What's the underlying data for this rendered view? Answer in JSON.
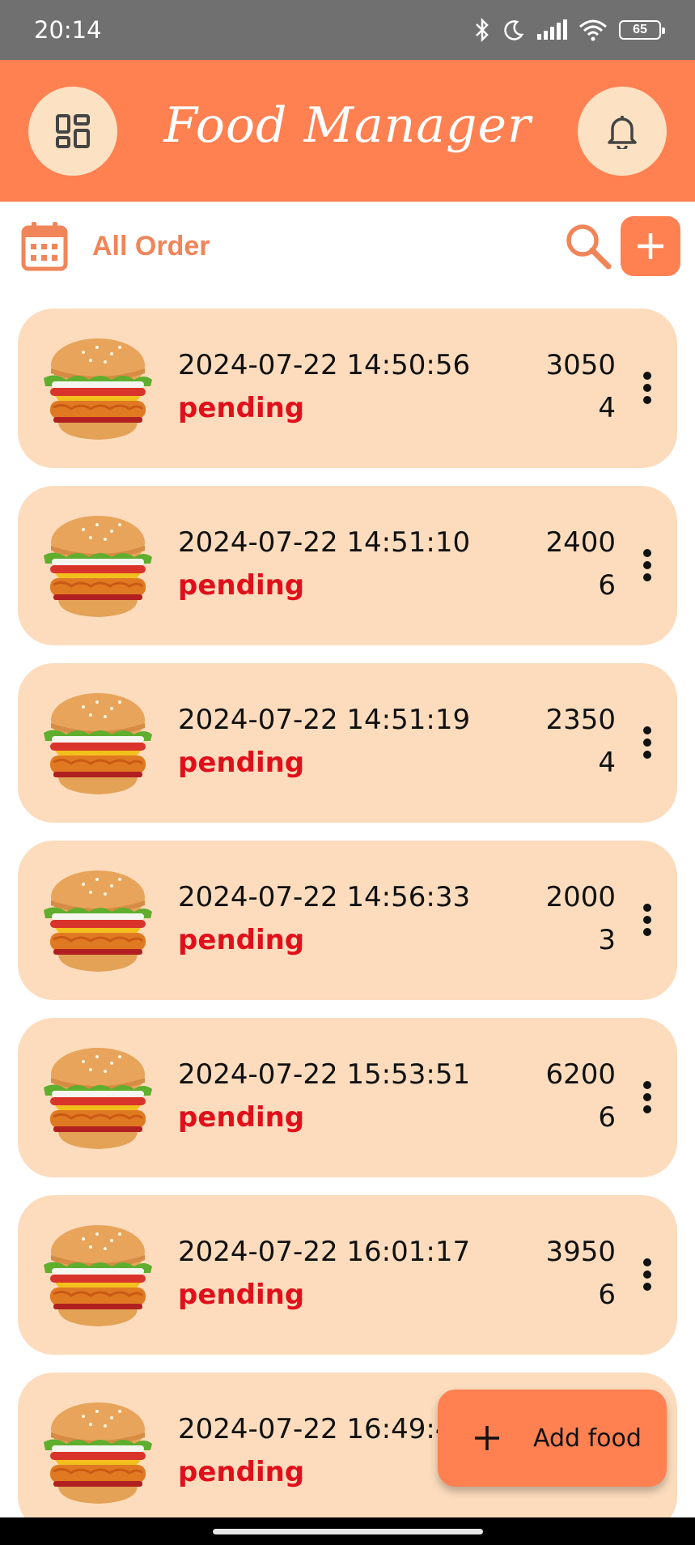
{
  "status_bar": {
    "time": "20:14",
    "battery": "65",
    "icons": [
      "bluetooth-icon",
      "moon-icon",
      "signal-icon",
      "wifi-icon",
      "battery-icon"
    ]
  },
  "app_bar": {
    "title": "Food Manager",
    "left_icon": "dashboard-icon",
    "right_icon": "bell-icon",
    "background": "#ff8051",
    "button_bg": "#fde1c3"
  },
  "filter": {
    "label": "All Order",
    "icons": [
      "calendar-icon",
      "search-icon",
      "plus-icon"
    ]
  },
  "orders": [
    {
      "date": "2024-07-22 14:50:56",
      "status": "pending",
      "total": "3050",
      "quantity": "4"
    },
    {
      "date": "2024-07-22 14:51:10",
      "status": "pending",
      "total": "2400",
      "quantity": "6"
    },
    {
      "date": "2024-07-22 14:51:19",
      "status": "pending",
      "total": "2350",
      "quantity": "4"
    },
    {
      "date": "2024-07-22 14:56:33",
      "status": "pending",
      "total": "2000",
      "quantity": "3"
    },
    {
      "date": "2024-07-22 15:53:51",
      "status": "pending",
      "total": "6200",
      "quantity": "6"
    },
    {
      "date": "2024-07-22 16:01:17",
      "status": "pending",
      "total": "3950",
      "quantity": "6"
    },
    {
      "date": "2024-07-22 16:49:4",
      "status": "pending",
      "total": "",
      "quantity": ""
    }
  ],
  "fab": {
    "label": "Add food",
    "icon": "plus-icon"
  },
  "colors": {
    "accent": "#ff8051",
    "card": "#fcdcbd",
    "status_pending": "#e0101b",
    "filter_label": "#f0855a"
  }
}
